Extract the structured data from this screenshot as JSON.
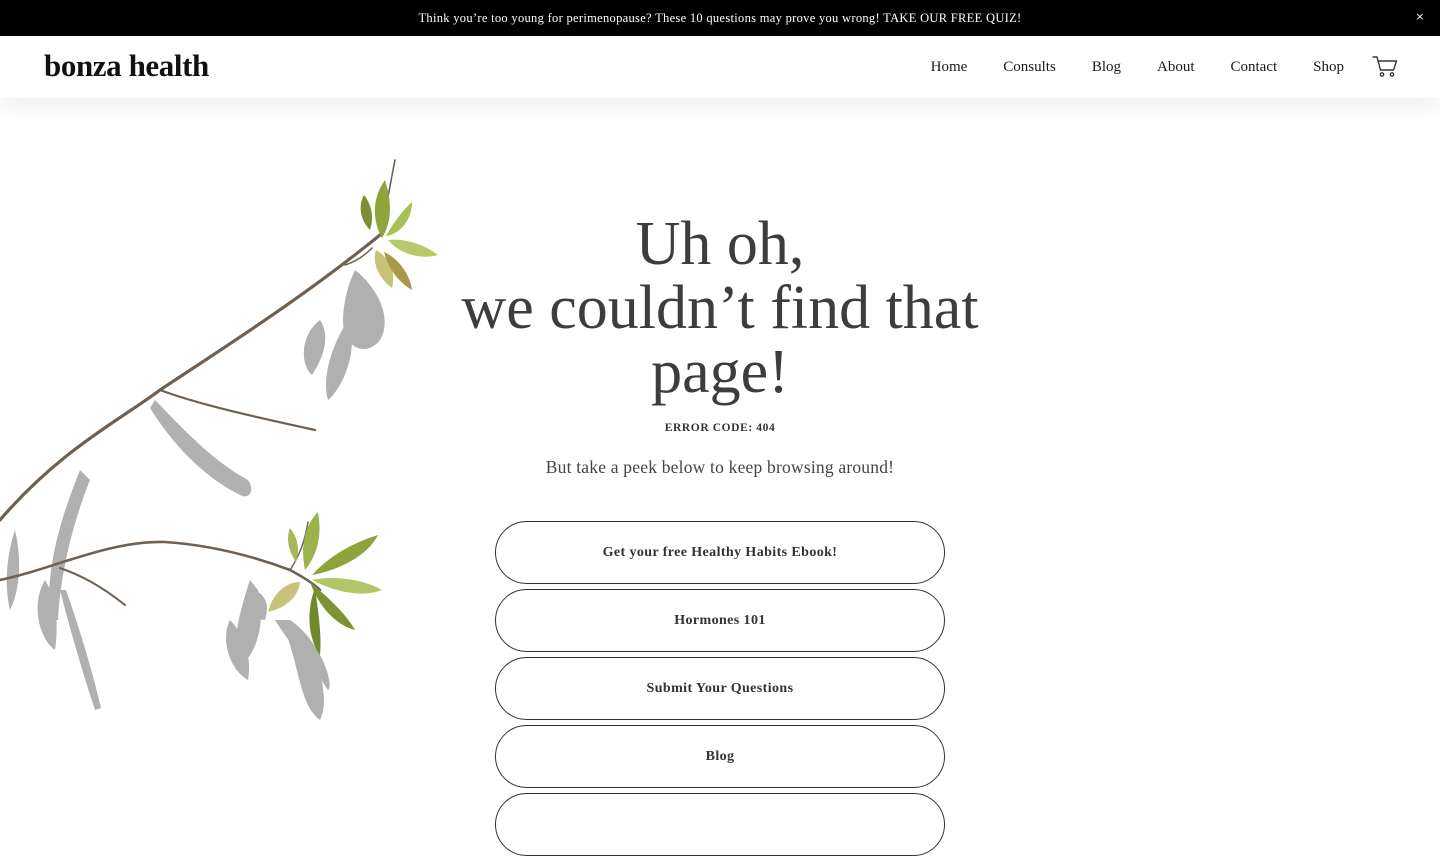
{
  "announcement": {
    "text": "Think you’re too young for perimenopause? These 10 questions may prove you wrong! TAKE OUR FREE QUIZ!",
    "close_icon": "close-icon",
    "close_glyph": "×",
    "background": "#000000",
    "color": "#ffffff"
  },
  "header": {
    "logo": "bonza health",
    "nav": [
      {
        "label": "Home"
      },
      {
        "label": "Consults"
      },
      {
        "label": "Blog"
      },
      {
        "label": "About"
      },
      {
        "label": "Contact"
      },
      {
        "label": "Shop"
      }
    ],
    "cart_icon": "cart-icon"
  },
  "main": {
    "headline_lines": [
      "Uh oh,",
      "we couldn’t find that",
      "page!"
    ],
    "error_code": "ERROR CODE: 404",
    "subtext": "But take a peek below to keep browsing around!",
    "buttons": [
      {
        "label": "Get your free Healthy Habits Ebook!"
      },
      {
        "label": "Hormones 101"
      },
      {
        "label": "Submit Your Questions"
      },
      {
        "label": "Blog"
      },
      {
        "label": ""
      }
    ],
    "illustration": "branch-with-leaves"
  },
  "colors": {
    "text": "#333333",
    "heading": "#3d3d3d",
    "leaf": "#9bb34a",
    "branch": "#6b5e52",
    "shadow": "#9a9a9a"
  }
}
